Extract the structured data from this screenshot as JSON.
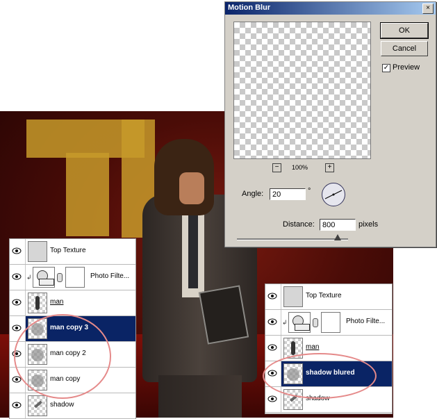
{
  "dialog": {
    "title": "Motion Blur",
    "close_glyph": "×",
    "ok_label": "OK",
    "cancel_label": "Cancel",
    "preview_label": "Preview",
    "preview_checked": "✓",
    "zoom_out": "−",
    "zoom_in": "+",
    "zoom_level": "100%",
    "angle_label": "Angle:",
    "angle_value": "20",
    "angle_unit": "°",
    "distance_label": "Distance:",
    "distance_value": "800",
    "distance_unit": "pixels"
  },
  "layers_left": [
    {
      "label": "Top Texture",
      "thumb": "texture"
    },
    {
      "label": "Photo Filte...",
      "thumb": "adjustment"
    },
    {
      "label": "man",
      "thumb": "man"
    },
    {
      "label": "man copy 3",
      "thumb": "blur",
      "selected": true
    },
    {
      "label": "man copy 2",
      "thumb": "blur"
    },
    {
      "label": "man copy",
      "thumb": "blur"
    },
    {
      "label": "shadow",
      "thumb": "shadow"
    }
  ],
  "layers_right": [
    {
      "label": "Top Texture",
      "thumb": "texture"
    },
    {
      "label": "Photo Filte...",
      "thumb": "adjustment"
    },
    {
      "label": "man",
      "thumb": "man"
    },
    {
      "label": "shadow blured",
      "thumb": "blur",
      "selected": true
    },
    {
      "label": "shadow",
      "thumb": "shadow"
    }
  ],
  "colors": {
    "selection": "#0a2465",
    "circle": "#e58a8a",
    "poster_red": "#7a1a10",
    "letter_gold": "#c79a2a"
  },
  "icons": [
    "eye-icon",
    "adjustment-icon",
    "chain-link-icon",
    "clip-arrow-icon",
    "close-icon",
    "angle-dial-icon"
  ]
}
